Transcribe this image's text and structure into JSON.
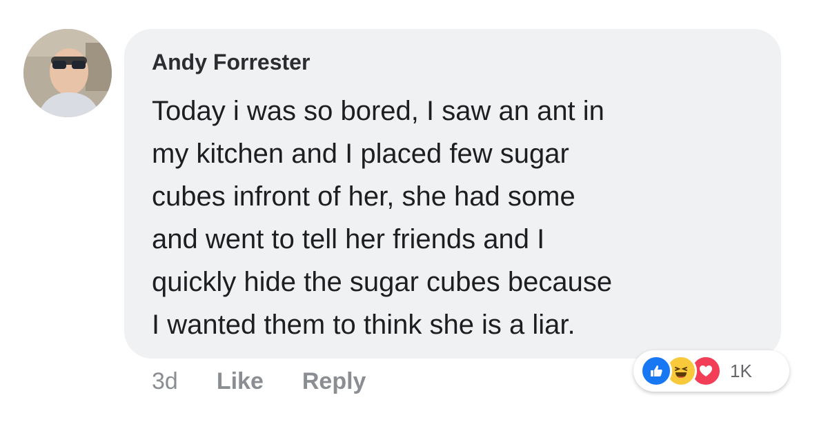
{
  "comment": {
    "author": "Andy Forrester",
    "lines": [
      "Today i was so bored, I saw an ant in",
      "my kitchen and I placed few sugar",
      "cubes infront of her, she had some",
      "and went to tell her friends and I",
      "quickly hide the sugar cubes because",
      "I wanted them to think she is a liar."
    ],
    "time": "3d",
    "like_label": "Like",
    "reply_label": "Reply"
  },
  "reactions": {
    "icons": [
      "like-icon",
      "haha-icon",
      "love-icon"
    ],
    "count": "1K",
    "colors": {
      "like": "#1877f2",
      "haha": "#f7c93b",
      "love": "#f33e58"
    }
  }
}
